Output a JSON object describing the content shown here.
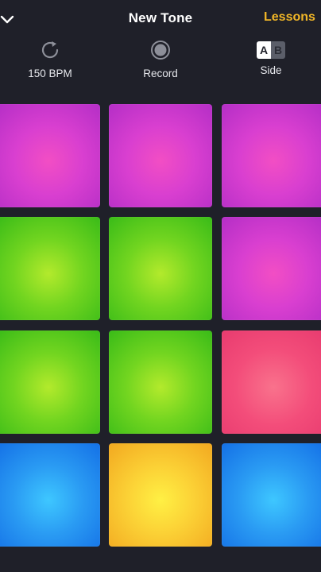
{
  "header": {
    "title": "New Tone",
    "lessons_label": "Lessons"
  },
  "toolbar": {
    "bpm_label": "150 BPM",
    "record_label": "Record",
    "side_label": "Side",
    "side_a": "A",
    "side_b": "B"
  },
  "pads": [
    {
      "color": "magenta"
    },
    {
      "color": "magenta"
    },
    {
      "color": "magenta"
    },
    {
      "color": "green"
    },
    {
      "color": "green"
    },
    {
      "color": "magenta"
    },
    {
      "color": "green"
    },
    {
      "color": "green"
    },
    {
      "color": "pink"
    },
    {
      "color": "blue"
    },
    {
      "color": "yellow"
    },
    {
      "color": "blue"
    }
  ],
  "colors": {
    "background": "#1f2029",
    "accent": "#f1b627",
    "magenta": "#d93fd0",
    "green": "#72d520",
    "pink": "#f34d7a",
    "blue": "#2a9bf3",
    "yellow": "#fbd035"
  }
}
